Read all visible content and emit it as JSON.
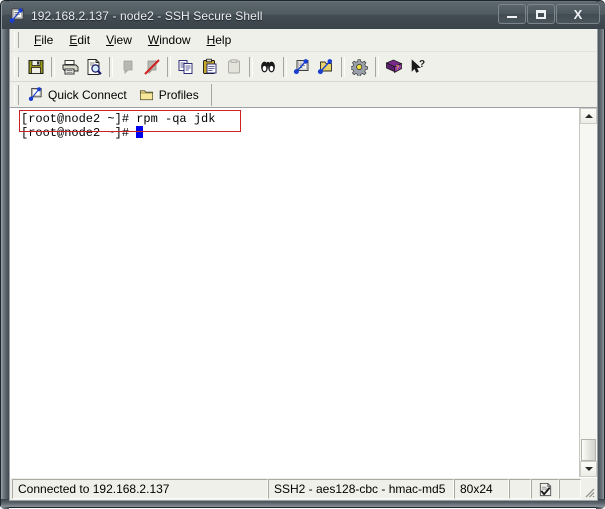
{
  "window": {
    "title": "192.168.2.137 - node2 - SSH Secure Shell",
    "icon": "ssh-terminal-icon",
    "caption": {
      "minimize_label": "Minimize",
      "maximize_label": "Maximize",
      "close_label": "X"
    }
  },
  "menubar": {
    "items": [
      {
        "label": "File",
        "accel": "F",
        "rest": "ile"
      },
      {
        "label": "Edit",
        "accel": "E",
        "rest": "dit"
      },
      {
        "label": "View",
        "accel": "V",
        "rest": "iew"
      },
      {
        "label": "Window",
        "accel": "W",
        "rest": "indow"
      },
      {
        "label": "Help",
        "accel": "H",
        "rest": "elp"
      }
    ]
  },
  "toolbar": {
    "buttons": [
      {
        "name": "save-icon",
        "tooltip": "Save",
        "enabled": true
      },
      {
        "name": "print-icon",
        "tooltip": "Print",
        "enabled": true
      },
      {
        "name": "print-preview-icon",
        "tooltip": "Print Preview",
        "enabled": true
      },
      {
        "name": "connect-icon",
        "tooltip": "Connect",
        "enabled": false
      },
      {
        "name": "disconnect-icon",
        "tooltip": "Disconnect",
        "enabled": false
      },
      {
        "name": "copy-icon",
        "tooltip": "Copy",
        "enabled": true
      },
      {
        "name": "paste-icon",
        "tooltip": "Paste",
        "enabled": true
      },
      {
        "name": "paste-clipboard-icon",
        "tooltip": "Paste Clipboard",
        "enabled": false
      },
      {
        "name": "find-icon",
        "tooltip": "Find",
        "enabled": true
      },
      {
        "name": "new-terminal-icon",
        "tooltip": "New Terminal Window",
        "enabled": true
      },
      {
        "name": "new-file-transfer-icon",
        "tooltip": "New File Transfer Window",
        "enabled": true
      },
      {
        "name": "settings-icon",
        "tooltip": "Settings",
        "enabled": true
      },
      {
        "name": "help-book-icon",
        "tooltip": "Help Contents",
        "enabled": true
      },
      {
        "name": "context-help-icon",
        "tooltip": "Context Help",
        "enabled": true
      }
    ]
  },
  "quickbar": {
    "quick_connect_label": "Quick Connect",
    "quick_connect_icon": "quick-connect-icon",
    "profiles_label": "Profiles",
    "profiles_icon": "folder-icon"
  },
  "terminal": {
    "lines": [
      "[root@node2 ~]# rpm -qa jdk",
      "[root@node2 ~]# "
    ],
    "cursor_line_index": 1,
    "highlight": {
      "color": "#cc2222",
      "target_line_index": 0
    },
    "background": "#ffffff",
    "foreground": "#000000",
    "cursor_color": "#0000f0"
  },
  "scrollbar": {
    "up_arrow": "scroll-up-arrow",
    "down_arrow": "scroll-down-arrow",
    "thumb_position": "bottom"
  },
  "statusbar": {
    "connection": "Connected to 192.168.2.137",
    "cipher": "SSH2 - aes128-cbc - hmac-md5",
    "size": "80x24",
    "indicator_icon": "transfer-status-icon",
    "resize_grip": "resize-grip"
  }
}
